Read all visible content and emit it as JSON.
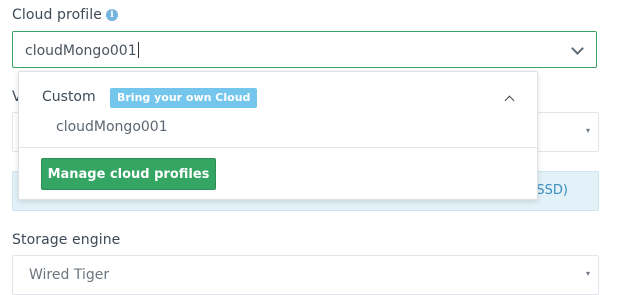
{
  "cloud_profile": {
    "label": "Cloud profile",
    "info_icon": "info-icon",
    "value": "cloudMongo001",
    "toggle_icon": "chevron-down-icon"
  },
  "dropdown": {
    "group_label": "Custom",
    "badge": "Bring your own Cloud",
    "collapse_icon": "chevron-up-icon",
    "options": [
      "cloudMongo001"
    ],
    "manage_button": "Manage cloud profiles"
  },
  "background": {
    "partial_label": "V",
    "info_tail": "SSD)",
    "select_arrow": "▾"
  },
  "storage_engine": {
    "label": "Storage engine",
    "value": "Wired Tiger",
    "arrow": "▾"
  },
  "colors": {
    "accent_green": "#34a562",
    "badge_blue": "#74c6ec",
    "info_bg": "#e3f2f8"
  }
}
